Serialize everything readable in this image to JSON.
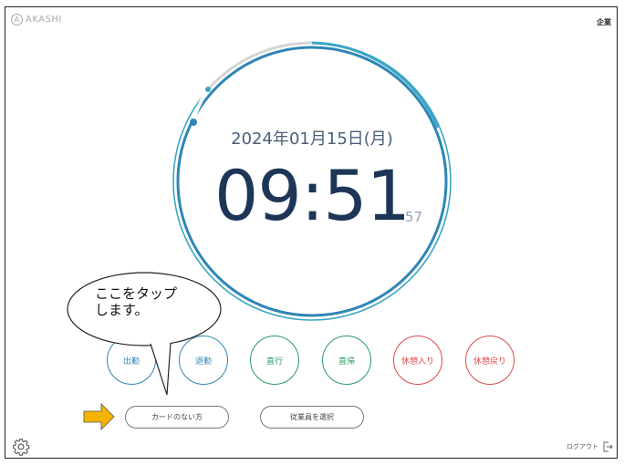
{
  "header": {
    "logo_text": "AKASHI",
    "company_label": "企業"
  },
  "clock": {
    "date": "2024年01月15日(月)",
    "time": "09:51",
    "seconds": "57"
  },
  "actions": [
    {
      "label": "出勤",
      "color": "#2f86b6"
    },
    {
      "label": "退勤",
      "color": "#2f86b6"
    },
    {
      "label": "直行",
      "color": "#2f9a63"
    },
    {
      "label": "直帰",
      "color": "#2f9a63"
    },
    {
      "label": "休憩入り",
      "color": "#dc4b4b"
    },
    {
      "label": "休憩戻り",
      "color": "#dc4b4b"
    }
  ],
  "buttons": {
    "no_card": "カードのない方",
    "select_employee": "従業員を選択"
  },
  "footer": {
    "logout": "ログアウト"
  },
  "annotation": {
    "line1": "ここをタップ",
    "line2": "します。"
  },
  "colors": {
    "ring_outer": "#3aa6c6",
    "ring_inner": "#2f86b6",
    "arrow": "#f5b400"
  }
}
